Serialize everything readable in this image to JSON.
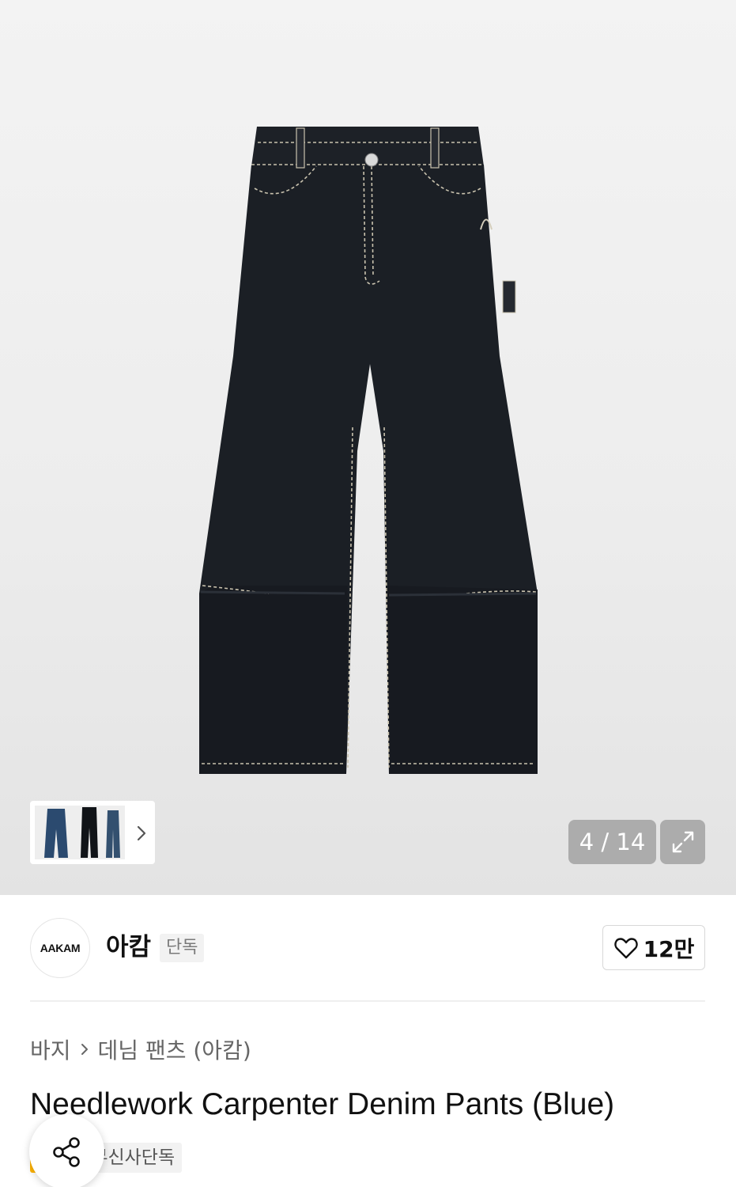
{
  "gallery": {
    "current_index": "4",
    "total": "14",
    "counter_text": "4 / 14",
    "product_image_alt": "black denim wide carpenter pants"
  },
  "brand": {
    "logo_text": "AAKAM",
    "name": "아캄",
    "badge": "단독",
    "likes": "12만"
  },
  "breadcrumb": {
    "level1": "바지",
    "level2": "데님 팬츠 (아캄)"
  },
  "product": {
    "title": "Needlework Carpenter Denim Pants (Blue)"
  },
  "tags": {
    "sale": "세일",
    "exclusive": "무신사단독"
  },
  "colors": {
    "sale_tag": "#ffb300",
    "denim": "#1c2026",
    "stitch": "#c9c2ae"
  },
  "icons": {
    "expand": "expand-icon",
    "heart": "heart-icon",
    "chevron": "chevron-right-icon",
    "share": "share-icon"
  }
}
